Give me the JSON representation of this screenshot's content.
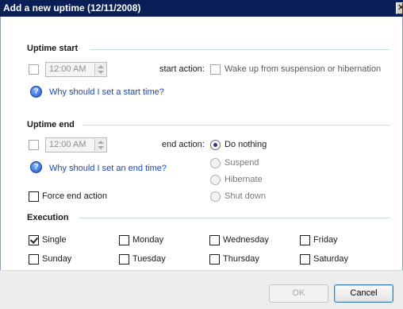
{
  "window": {
    "title": "Add a new uptime (12/11/2008)",
    "close_label": "✕"
  },
  "uptime_start": {
    "header": "Uptime start",
    "time_value": "12:00 AM",
    "action_label": "start action:",
    "wake_label": "Wake up from suspension or hibernation",
    "help_text": "Why should I set a start time?"
  },
  "uptime_end": {
    "header": "Uptime end",
    "time_value": "12:00 AM",
    "action_label": "end action:",
    "help_text": "Why should I set an end time?",
    "force_label": "Force end action",
    "actions": [
      "Do nothing",
      "Suspend",
      "Hibernate",
      "Shut down"
    ],
    "selected_action": "Do nothing"
  },
  "execution": {
    "header": "Execution",
    "days": [
      "Single",
      "Monday",
      "Wednesday",
      "Friday",
      "Sunday",
      "Tuesday",
      "Thursday",
      "Saturday"
    ],
    "checked": [
      "Single"
    ]
  },
  "buttons": {
    "ok": "OK",
    "cancel": "Cancel"
  },
  "colors": {
    "title_bar": "#0b1f57",
    "link": "#1a47b8",
    "section_line": "#c9d8e6"
  }
}
